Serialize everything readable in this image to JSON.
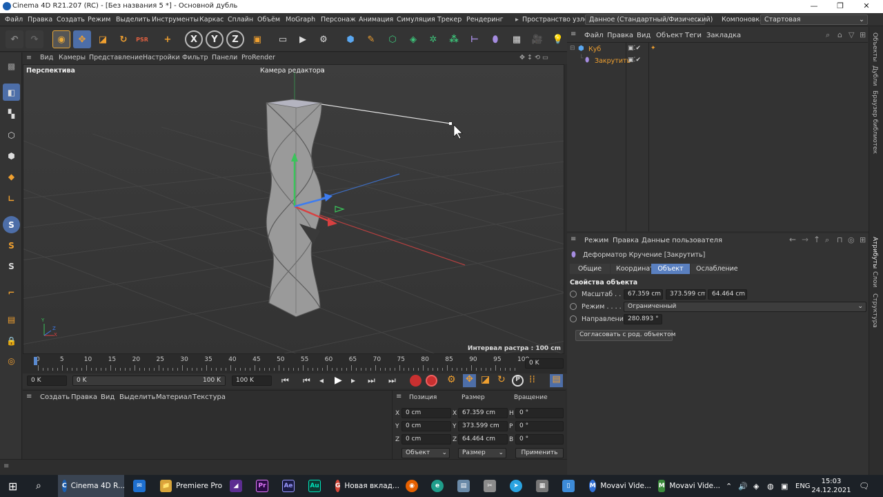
{
  "window": {
    "title": "Cinema 4D R21.207 (RC) - [Без названия 5 *] - Основной дубль",
    "minimize": "—",
    "maximize": "❐",
    "close": "✕"
  },
  "menubar": {
    "items": [
      "Файл",
      "Правка",
      "Создать",
      "Режим",
      "Выделить",
      "Инструменты",
      "Каркас",
      "Сплайн",
      "Объём",
      "MoGraph",
      "Персонаж",
      "Анимация",
      "Симуляция",
      "Трекер",
      "Рендеринг"
    ],
    "node_space_label": "Пространство узлов:",
    "node_space_value": "Данное (Стандартный/Физический)",
    "layout_label": "Компоновка",
    "layout_value": "Стартовая"
  },
  "toolbar": {
    "axis_x": "X",
    "axis_y": "Y",
    "axis_z": "Z",
    "psr": "PSR"
  },
  "viewport_menu": {
    "items": [
      "Вид",
      "Камеры",
      "Представление",
      "Настройки",
      "Фильтр",
      "Панели",
      "ProRender"
    ]
  },
  "viewport": {
    "label": "Перспектива",
    "camera": "Камера редактора",
    "grid_spacing": "Интервал растра : 100 cm",
    "axis_x": "X",
    "axis_y": "Y",
    "axis_z": "Z"
  },
  "left_tools": {
    "s_label": "S"
  },
  "timeline": {
    "ticks": [
      "0",
      "5",
      "10",
      "15",
      "20",
      "25",
      "30",
      "35",
      "40",
      "45",
      "50",
      "55",
      "60",
      "65",
      "70",
      "75",
      "80",
      "85",
      "90",
      "95",
      "100"
    ],
    "current_frame": "0 K"
  },
  "transport": {
    "start": "0 K",
    "range_start": "0 K",
    "range_end": "100 K",
    "end": "100 K"
  },
  "material_panel": {
    "menu": [
      "Создать",
      "Правка",
      "Вид",
      "Выделить",
      "Материал",
      "Текстура"
    ]
  },
  "coord_panel": {
    "headers": [
      "Позиция",
      "Размер",
      "Вращение"
    ],
    "rows": [
      {
        "axis": "X",
        "pos": "0 cm",
        "size_axis": "X",
        "size": "67.359 cm",
        "rot_axis": "H",
        "rot": "0 °"
      },
      {
        "axis": "Y",
        "pos": "0 cm",
        "size_axis": "Y",
        "size": "373.599 cm",
        "rot_axis": "P",
        "rot": "0 °"
      },
      {
        "axis": "Z",
        "pos": "0 cm",
        "size_axis": "Z",
        "size": "64.464 cm",
        "rot_axis": "B",
        "rot": "0 °"
      }
    ],
    "mode_object": "Объект",
    "mode_size": "Размер",
    "apply": "Применить"
  },
  "object_panel": {
    "menu": [
      "Файл",
      "Правка",
      "Вид",
      "Объект",
      "Теги",
      "Закладка"
    ],
    "objects": [
      {
        "name": "Куб"
      },
      {
        "name": "Закрутить"
      }
    ]
  },
  "attr_panel": {
    "menu": [
      "Режим",
      "Правка",
      "Данные пользователя"
    ],
    "title": "Деформатор Кручение [Закрутить]",
    "tabs": [
      "Общие",
      "Координаты",
      "Объект",
      "Ослабление"
    ],
    "section": "Свойства объекта",
    "size_label": "Масштаб . . . .",
    "size_x": "67.359 cm",
    "size_y": "373.599 cm",
    "size_z": "64.464 cm",
    "mode_label": "Режим . . . . . .",
    "mode_value": "Ограниченный",
    "angle_label": "Направление",
    "angle_value": "280.893 °",
    "match_button": "Согласовать с род. объектом"
  },
  "right_strip": [
    "Объекты",
    "Дубли",
    "Браузер библиотек",
    "Атрибуты",
    "Слои",
    "Структура"
  ],
  "taskbar": {
    "apps": [
      {
        "label": "Cinema 4D R...",
        "color": "#1a5eb0",
        "icon": "C"
      },
      {
        "label": "Premiere Pro",
        "color": "#d8a53a",
        "icon": "📁"
      },
      {
        "label": "Новая вклад...",
        "color": "#d44638",
        "icon": "G"
      },
      {
        "label": "Movavi Vide...",
        "color": "#2f6fd6",
        "icon": "M"
      },
      {
        "label": "Movavi Vide...",
        "color": "#3b8b3b",
        "icon": "M"
      }
    ],
    "pr": "Pr",
    "ae": "Ae",
    "au": "Au",
    "lang": "ENG",
    "time": "15:03",
    "date": "24.12.2021"
  }
}
